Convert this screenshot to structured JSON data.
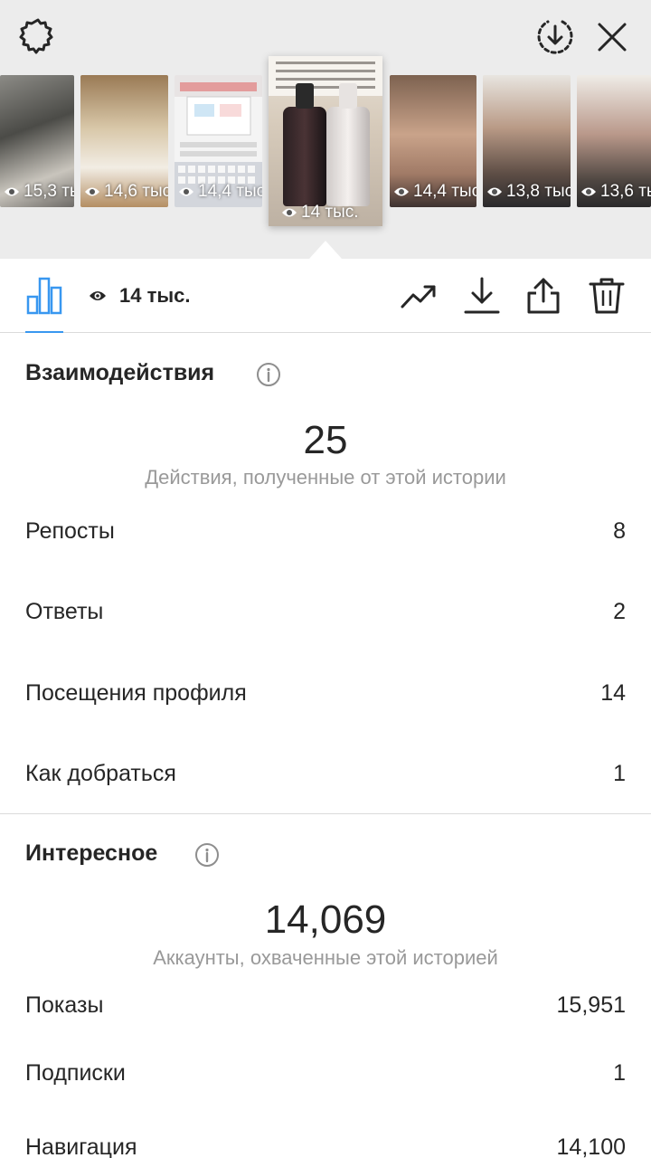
{
  "header": {
    "icons": [
      "gear-icon",
      "download-circle-icon",
      "close-icon"
    ]
  },
  "stories": [
    {
      "views": "15,3 тыс."
    },
    {
      "views": "14,6 тыс."
    },
    {
      "views": "14,4 тыс."
    },
    {
      "views": "14 тыс.",
      "selected": true
    },
    {
      "views": "14,4 тыс."
    },
    {
      "views": "13,8 тыс."
    },
    {
      "views": "13,6 тыс."
    }
  ],
  "toolbar": {
    "view_count": "14 тыс.",
    "icons": [
      "bar-chart-icon",
      "eye-icon",
      "trend-icon",
      "download-icon",
      "share-icon",
      "trash-icon"
    ],
    "accent_color": "#3897f0"
  },
  "interactions": {
    "title": "Взаимодействия",
    "total": "25",
    "total_caption": "Действия, полученные от этой истории",
    "rows": [
      {
        "label": "Репосты",
        "value": "8"
      },
      {
        "label": "Ответы",
        "value": "2"
      },
      {
        "label": "Посещения профиля",
        "value": "14"
      },
      {
        "label": "Как добраться",
        "value": "1"
      }
    ]
  },
  "discovery": {
    "title": "Интересное",
    "total": "14,069",
    "total_caption": "Аккаунты, охваченные этой историей",
    "rows": [
      {
        "label": "Показы",
        "value": "15,951"
      },
      {
        "label": "Подписки",
        "value": "1"
      },
      {
        "label": "Навигация",
        "value": "14,100"
      }
    ]
  }
}
